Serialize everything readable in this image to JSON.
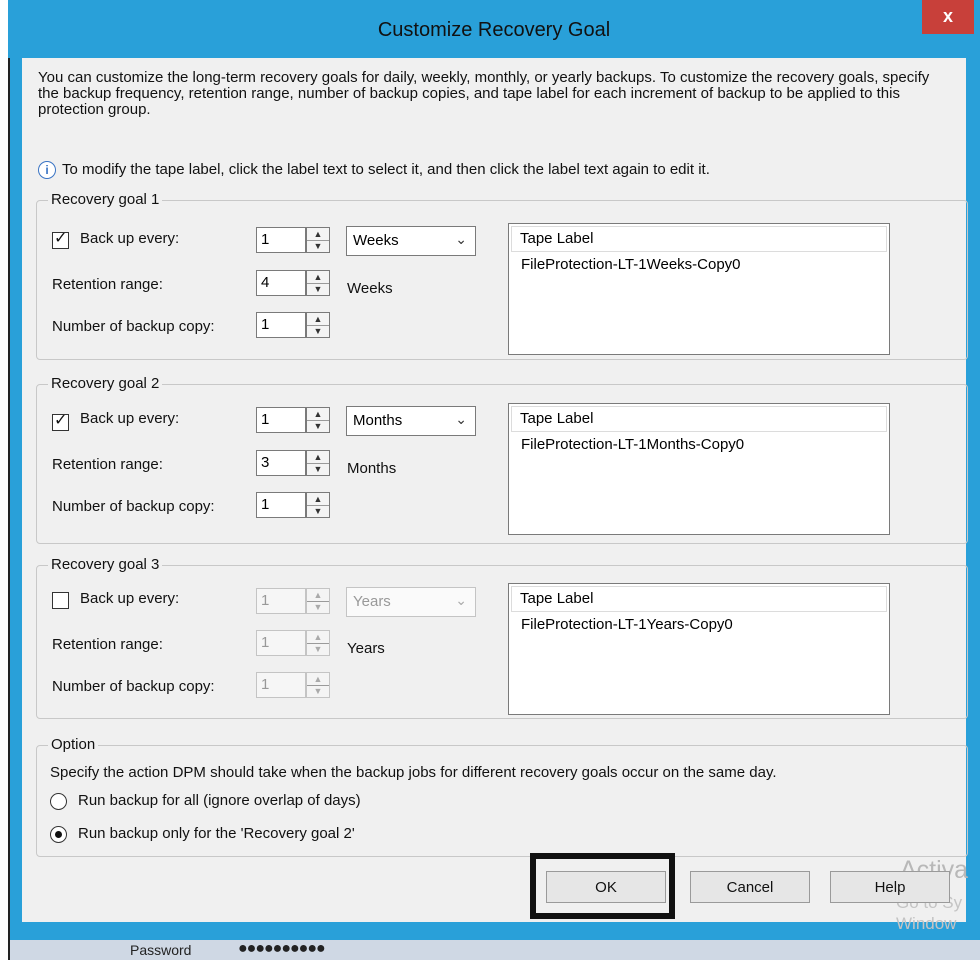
{
  "window": {
    "title": "Customize Recovery Goal",
    "close_label": "x"
  },
  "intro_text": "You can customize the long-term recovery goals for daily, weekly, monthly, or yearly backups. To customize the recovery goals, specify the backup frequency, retention range, number of backup copies, and tape label for each increment of backup to be applied to this protection group.",
  "info_text": "To modify the tape label, click the label text to select it, and then click the label text again to edit it.",
  "info_icon": "i",
  "labels": {
    "backup_every": "Back up every:",
    "retention": "Retention range:",
    "copies": "Number of backup copy:",
    "tape_header": "Tape Label"
  },
  "goals": [
    {
      "title": "Recovery goal 1",
      "checked": true,
      "enabled": true,
      "every_value": "1",
      "period": "Weeks",
      "retention_value": "4",
      "retention_unit": "Weeks",
      "copies": "1",
      "tape_label": "FileProtection-LT-1Weeks-Copy0"
    },
    {
      "title": "Recovery goal 2",
      "checked": true,
      "enabled": true,
      "every_value": "1",
      "period": "Months",
      "retention_value": "3",
      "retention_unit": "Months",
      "copies": "1",
      "tape_label": "FileProtection-LT-1Months-Copy0"
    },
    {
      "title": "Recovery goal 3",
      "checked": false,
      "enabled": false,
      "every_value": "1",
      "period": "Years",
      "retention_value": "1",
      "retention_unit": "Years",
      "copies": "1",
      "tape_label": "FileProtection-LT-1Years-Copy0"
    }
  ],
  "option": {
    "title": "Option",
    "description": "Specify the action DPM should take when the backup jobs for different recovery goals occur on the same day.",
    "radio_all": "Run backup for all (ignore overlap of days)",
    "radio_goal": "Run backup only for the 'Recovery goal 2'",
    "selected": "radio_goal"
  },
  "buttons": {
    "ok": "OK",
    "cancel": "Cancel",
    "help": "Help"
  },
  "watermark": {
    "line1": "Activa",
    "line2": "Go to Sy",
    "line3": "Window"
  },
  "taskbar": {
    "label": "Password",
    "masked": "●●●●●●●●●●"
  },
  "colors": {
    "titlebar": "#29a0d9",
    "close": "#c8403a",
    "dialog_bg": "#f0f0f0"
  }
}
